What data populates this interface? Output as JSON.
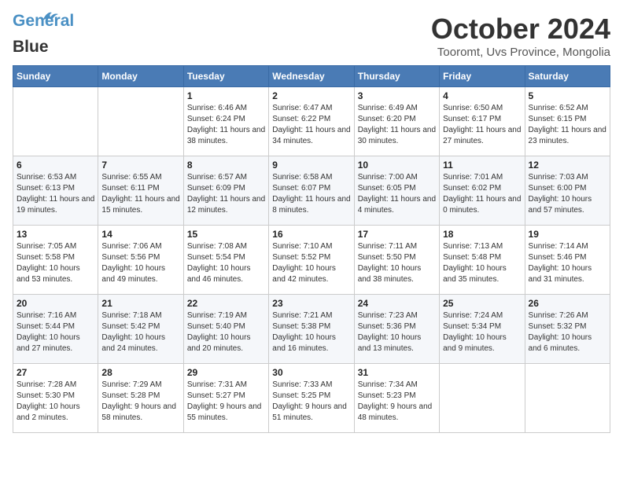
{
  "header": {
    "logo_line1": "General",
    "logo_line2": "Blue",
    "month": "October 2024",
    "location": "Tooromt, Uvs Province, Mongolia"
  },
  "weekdays": [
    "Sunday",
    "Monday",
    "Tuesday",
    "Wednesday",
    "Thursday",
    "Friday",
    "Saturday"
  ],
  "weeks": [
    [
      {
        "day": "",
        "info": ""
      },
      {
        "day": "",
        "info": ""
      },
      {
        "day": "1",
        "info": "Sunrise: 6:46 AM\nSunset: 6:24 PM\nDaylight: 11 hours and 38 minutes."
      },
      {
        "day": "2",
        "info": "Sunrise: 6:47 AM\nSunset: 6:22 PM\nDaylight: 11 hours and 34 minutes."
      },
      {
        "day": "3",
        "info": "Sunrise: 6:49 AM\nSunset: 6:20 PM\nDaylight: 11 hours and 30 minutes."
      },
      {
        "day": "4",
        "info": "Sunrise: 6:50 AM\nSunset: 6:17 PM\nDaylight: 11 hours and 27 minutes."
      },
      {
        "day": "5",
        "info": "Sunrise: 6:52 AM\nSunset: 6:15 PM\nDaylight: 11 hours and 23 minutes."
      }
    ],
    [
      {
        "day": "6",
        "info": "Sunrise: 6:53 AM\nSunset: 6:13 PM\nDaylight: 11 hours and 19 minutes."
      },
      {
        "day": "7",
        "info": "Sunrise: 6:55 AM\nSunset: 6:11 PM\nDaylight: 11 hours and 15 minutes."
      },
      {
        "day": "8",
        "info": "Sunrise: 6:57 AM\nSunset: 6:09 PM\nDaylight: 11 hours and 12 minutes."
      },
      {
        "day": "9",
        "info": "Sunrise: 6:58 AM\nSunset: 6:07 PM\nDaylight: 11 hours and 8 minutes."
      },
      {
        "day": "10",
        "info": "Sunrise: 7:00 AM\nSunset: 6:05 PM\nDaylight: 11 hours and 4 minutes."
      },
      {
        "day": "11",
        "info": "Sunrise: 7:01 AM\nSunset: 6:02 PM\nDaylight: 11 hours and 0 minutes."
      },
      {
        "day": "12",
        "info": "Sunrise: 7:03 AM\nSunset: 6:00 PM\nDaylight: 10 hours and 57 minutes."
      }
    ],
    [
      {
        "day": "13",
        "info": "Sunrise: 7:05 AM\nSunset: 5:58 PM\nDaylight: 10 hours and 53 minutes."
      },
      {
        "day": "14",
        "info": "Sunrise: 7:06 AM\nSunset: 5:56 PM\nDaylight: 10 hours and 49 minutes."
      },
      {
        "day": "15",
        "info": "Sunrise: 7:08 AM\nSunset: 5:54 PM\nDaylight: 10 hours and 46 minutes."
      },
      {
        "day": "16",
        "info": "Sunrise: 7:10 AM\nSunset: 5:52 PM\nDaylight: 10 hours and 42 minutes."
      },
      {
        "day": "17",
        "info": "Sunrise: 7:11 AM\nSunset: 5:50 PM\nDaylight: 10 hours and 38 minutes."
      },
      {
        "day": "18",
        "info": "Sunrise: 7:13 AM\nSunset: 5:48 PM\nDaylight: 10 hours and 35 minutes."
      },
      {
        "day": "19",
        "info": "Sunrise: 7:14 AM\nSunset: 5:46 PM\nDaylight: 10 hours and 31 minutes."
      }
    ],
    [
      {
        "day": "20",
        "info": "Sunrise: 7:16 AM\nSunset: 5:44 PM\nDaylight: 10 hours and 27 minutes."
      },
      {
        "day": "21",
        "info": "Sunrise: 7:18 AM\nSunset: 5:42 PM\nDaylight: 10 hours and 24 minutes."
      },
      {
        "day": "22",
        "info": "Sunrise: 7:19 AM\nSunset: 5:40 PM\nDaylight: 10 hours and 20 minutes."
      },
      {
        "day": "23",
        "info": "Sunrise: 7:21 AM\nSunset: 5:38 PM\nDaylight: 10 hours and 16 minutes."
      },
      {
        "day": "24",
        "info": "Sunrise: 7:23 AM\nSunset: 5:36 PM\nDaylight: 10 hours and 13 minutes."
      },
      {
        "day": "25",
        "info": "Sunrise: 7:24 AM\nSunset: 5:34 PM\nDaylight: 10 hours and 9 minutes."
      },
      {
        "day": "26",
        "info": "Sunrise: 7:26 AM\nSunset: 5:32 PM\nDaylight: 10 hours and 6 minutes."
      }
    ],
    [
      {
        "day": "27",
        "info": "Sunrise: 7:28 AM\nSunset: 5:30 PM\nDaylight: 10 hours and 2 minutes."
      },
      {
        "day": "28",
        "info": "Sunrise: 7:29 AM\nSunset: 5:28 PM\nDaylight: 9 hours and 58 minutes."
      },
      {
        "day": "29",
        "info": "Sunrise: 7:31 AM\nSunset: 5:27 PM\nDaylight: 9 hours and 55 minutes."
      },
      {
        "day": "30",
        "info": "Sunrise: 7:33 AM\nSunset: 5:25 PM\nDaylight: 9 hours and 51 minutes."
      },
      {
        "day": "31",
        "info": "Sunrise: 7:34 AM\nSunset: 5:23 PM\nDaylight: 9 hours and 48 minutes."
      },
      {
        "day": "",
        "info": ""
      },
      {
        "day": "",
        "info": ""
      }
    ]
  ]
}
